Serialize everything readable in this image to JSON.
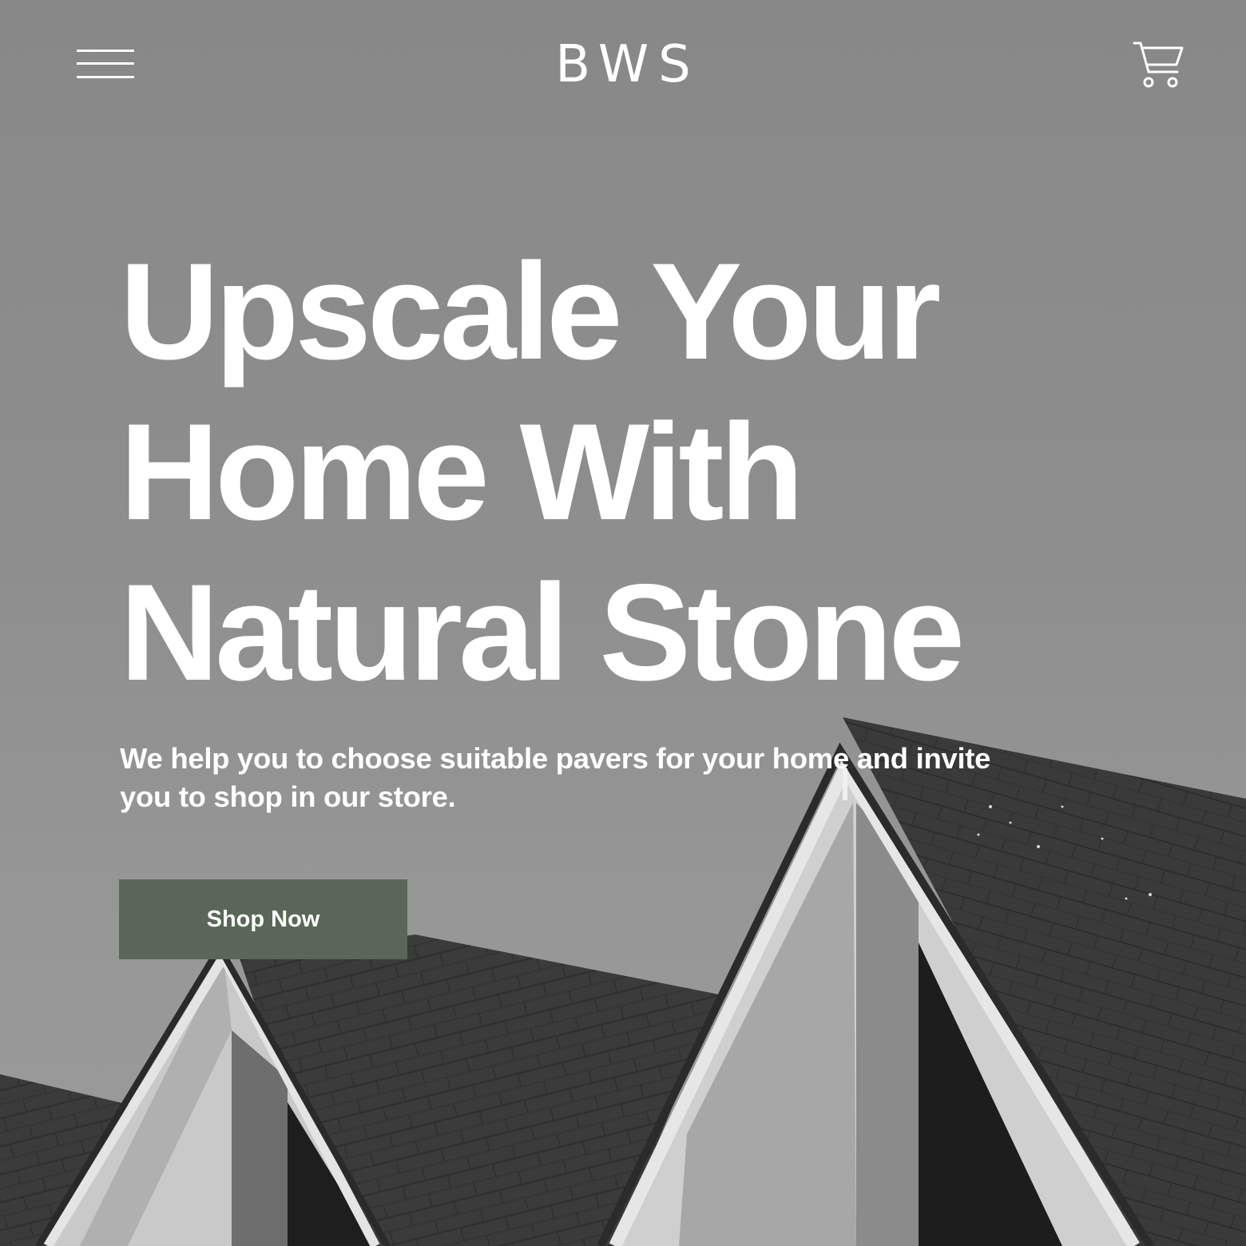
{
  "header": {
    "menu_icon": "hamburger-menu-icon",
    "logo": "BWS",
    "cart_icon": "shopping-cart-icon"
  },
  "hero": {
    "headline_lines": [
      "Upscale Your",
      "Home With",
      "Natural Stone"
    ],
    "subtext": "We help you to choose suitable pavers for your home and invite you to shop in our store.",
    "cta_label": "Shop Now"
  },
  "colors": {
    "cta_background": "#5a6758",
    "text": "#ffffff",
    "sky": "#8e8e8e"
  }
}
